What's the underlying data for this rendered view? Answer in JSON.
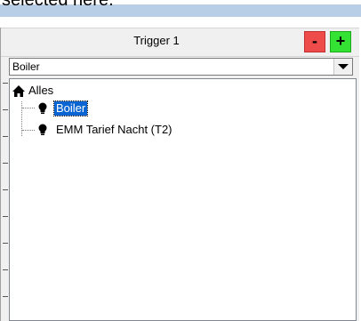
{
  "caption": {
    "text": "selected here."
  },
  "panel": {
    "title": "Trigger 1",
    "remove_label": "-",
    "add_label": "+"
  },
  "combo": {
    "value": "Boiler"
  },
  "tree": {
    "root": {
      "label": "Alles",
      "icon": "home-icon"
    },
    "items": [
      {
        "label": "Boiler",
        "icon": "bulb-icon",
        "selected": true
      },
      {
        "label": "EMM Tarief Nacht (T2)",
        "icon": "bulb-icon",
        "selected": false
      }
    ]
  },
  "colors": {
    "remove_button": "#ee4b4b",
    "add_button": "#33e233",
    "selection": "#0a64d2"
  }
}
